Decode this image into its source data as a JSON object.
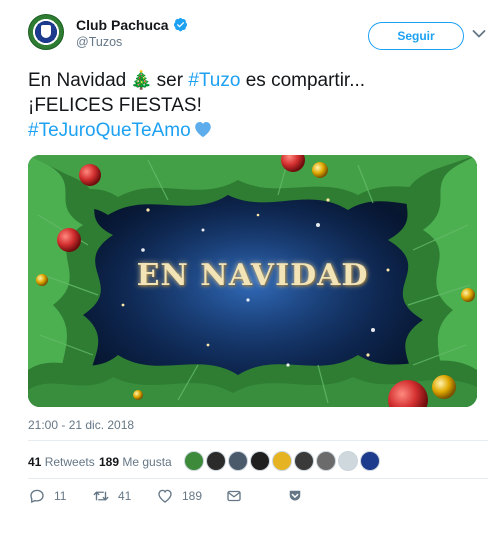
{
  "account": {
    "name": "Club Pachuca",
    "handle": "@Tuzos",
    "follow_label": "Seguir"
  },
  "tweet": {
    "line1_prefix": "En Navidad",
    "line1_emoji": "🎄",
    "line1_middle": "ser",
    "line1_hashtag": "#Tuzo",
    "line1_suffix": "es compartir...",
    "line2": "¡FELICES FIESTAS!",
    "line3_hashtag": "#TeJuroQueTeAmo",
    "heart_color": "#5dadec"
  },
  "media": {
    "title": "EN NAVIDAD"
  },
  "timestamp": "21:00 - 21 dic. 2018",
  "stats": {
    "retweets_count": "41",
    "retweets_label": "Retweets",
    "likes_count": "189",
    "likes_label": "Me gusta"
  },
  "likers": [
    {
      "icon": "green-avatar",
      "color": "#3d8a3a"
    },
    {
      "icon": "dark-avatar",
      "color": "#2b2b2b"
    },
    {
      "icon": "person-avatar",
      "color": "#4a5a6a"
    },
    {
      "icon": "car-avatar",
      "color": "#1f1f1f"
    },
    {
      "icon": "yellow-avatar",
      "color": "#e6b422"
    },
    {
      "icon": "black-avatar",
      "color": "#3a3a3a"
    },
    {
      "icon": "ball-avatar",
      "color": "#6b6b6b"
    },
    {
      "icon": "white-avatar",
      "color": "#cfd8dc"
    },
    {
      "icon": "club-avatar",
      "color": "#1d3b8c"
    }
  ],
  "actions": {
    "replies": "11",
    "retweets": "41",
    "likes": "189"
  },
  "colors": {
    "accent": "#1da1f2",
    "muted": "#657786",
    "text": "#14171a"
  }
}
